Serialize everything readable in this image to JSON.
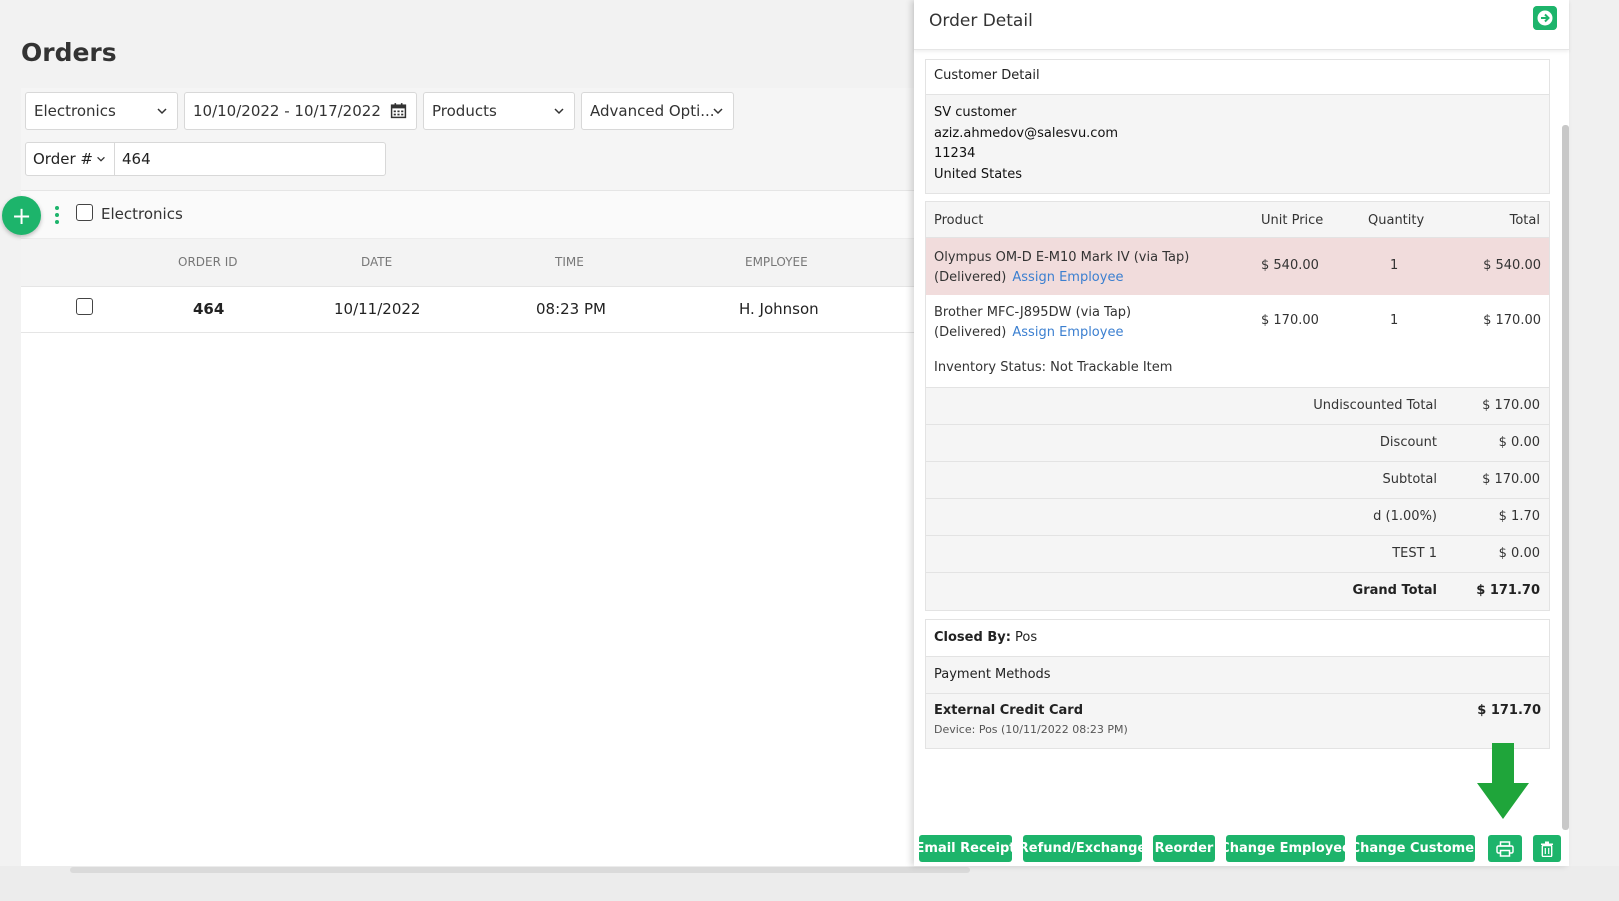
{
  "page": {
    "title": "Orders"
  },
  "filters": {
    "location": "Electronics",
    "date_range": "10/10/2022 - 10/17/2022",
    "products": "Products",
    "advanced": "Advanced Opti...",
    "search_by": "Order #",
    "search_value": "464"
  },
  "group": {
    "label": "Electronics"
  },
  "table": {
    "headers": [
      "ORDER ID",
      "DATE",
      "TIME",
      "EMPLOYEE"
    ],
    "rows": [
      {
        "order_id": "464",
        "date": "10/11/2022",
        "time": "08:23 PM",
        "employee": "H. Johnson"
      }
    ]
  },
  "detail": {
    "title": "Order Detail",
    "customer_section": "Customer Detail",
    "customer": {
      "name": "SV customer",
      "email": "aziz.ahmedov@salesvu.com",
      "zip": "11234",
      "country": "United States"
    },
    "products_header": {
      "product": "Product",
      "unit_price": "Unit Price",
      "quantity": "Quantity",
      "total": "Total"
    },
    "products": [
      {
        "name": "Olympus OM-D E-M10 Mark IV (via Tap)",
        "status": "(Delivered)",
        "assign": "Assign Employee",
        "unit_price": "$ 540.00",
        "qty": "1",
        "total": "$ 540.00"
      },
      {
        "name": "Brother MFC-J895DW (via Tap)",
        "status": "(Delivered)",
        "assign": "Assign Employee",
        "unit_price": "$ 170.00",
        "qty": "1",
        "total": "$ 170.00"
      }
    ],
    "inventory_status": "Inventory Status: Not Trackable Item",
    "totals": [
      {
        "label": "Undiscounted Total",
        "value": "$ 170.00"
      },
      {
        "label": "Discount",
        "value": "$ 0.00"
      },
      {
        "label": "Subtotal",
        "value": "$ 170.00"
      },
      {
        "label": "d (1.00%)",
        "value": "$ 1.70"
      },
      {
        "label": "TEST 1",
        "value": "$ 0.00"
      },
      {
        "label": "Grand Total",
        "value": "$ 171.70"
      }
    ],
    "closed_by_label": "Closed By:",
    "closed_by_value": "Pos",
    "payment_methods_label": "Payment Methods",
    "payment": {
      "name": "External Credit Card",
      "device": "Device: Pos (10/11/2022 08:23 PM)",
      "amount": "$ 171.70"
    },
    "actions": {
      "email": "Email Receipt",
      "refund": "Refund/Exchange",
      "reorder": "Reorder",
      "change_employee": "Change Employee",
      "change_customer": "Change Customer"
    }
  },
  "colors": {
    "accent": "#1db46b",
    "highlight_row": "#f1dcdc",
    "link": "#3b7fd0",
    "annotation_arrow": "#1fa53a"
  }
}
